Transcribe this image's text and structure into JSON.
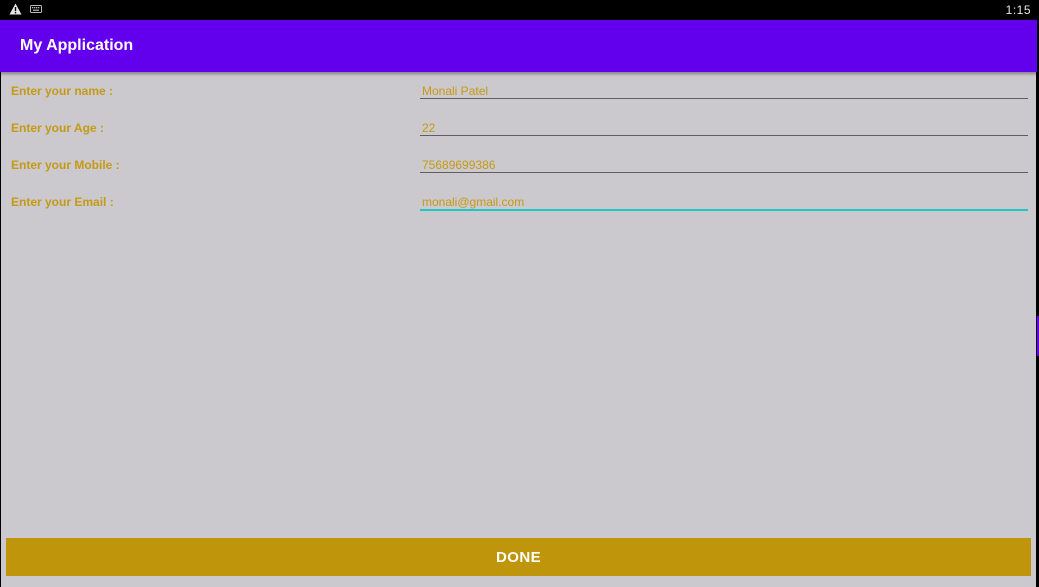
{
  "status_bar": {
    "time": "1:15",
    "icons": [
      "warning-icon",
      "keyboard-icon"
    ]
  },
  "app_bar": {
    "title": "My Application"
  },
  "form": {
    "rows": [
      {
        "label": "Enter your name :",
        "value": "Monali Patel"
      },
      {
        "label": "Enter your Age :",
        "value": "22"
      },
      {
        "label": "Enter your Mobile :",
        "value": "75689699386"
      },
      {
        "label": "Enter your Email :",
        "value": "monali@gmail.com",
        "focused": true
      }
    ]
  },
  "done_button": {
    "label": "DONE"
  },
  "colors": {
    "app_bar": "#6200ee",
    "background": "#cbc9ce",
    "label_text": "#c59a13",
    "button": "#bf950c",
    "focus_underline": "#1ec6c6"
  }
}
